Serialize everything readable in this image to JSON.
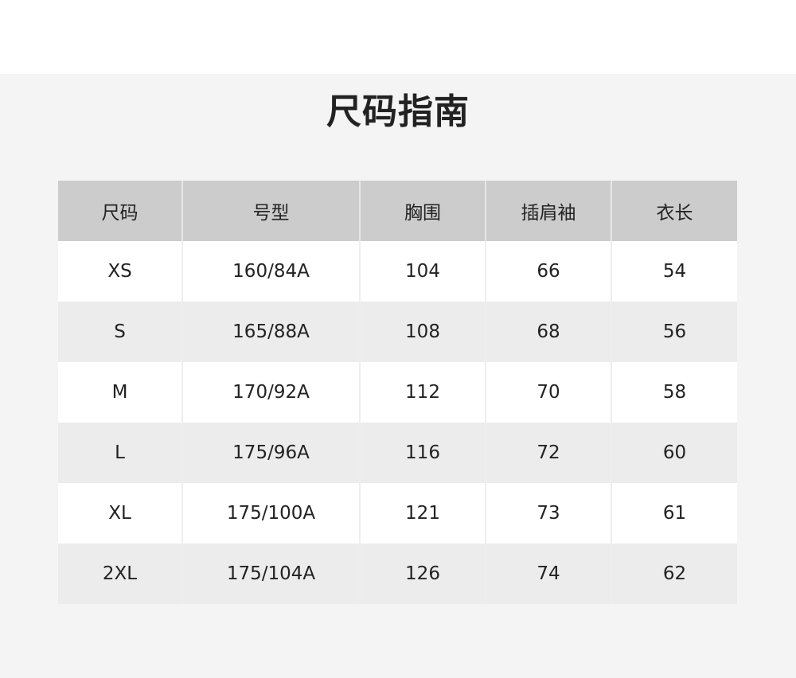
{
  "title": "尺码指南",
  "table": {
    "headers": [
      "尺码",
      "号型",
      "胸围",
      "插肩袖",
      "衣长"
    ],
    "rows": [
      [
        "XS",
        "160/84A",
        "104",
        "66",
        "54"
      ],
      [
        "S",
        "165/88A",
        "108",
        "68",
        "56"
      ],
      [
        "M",
        "170/92A",
        "112",
        "70",
        "58"
      ],
      [
        "L",
        "175/96A",
        "116",
        "72",
        "60"
      ],
      [
        "XL",
        "175/100A",
        "121",
        "73",
        "61"
      ],
      [
        "2XL",
        "175/104A",
        "126",
        "74",
        "62"
      ]
    ]
  },
  "colors": {
    "page_background": "#f4f4f4",
    "header_background": "#cccccc",
    "row_light": "#ffffff",
    "row_dark": "#ececec",
    "text": "#222222"
  }
}
